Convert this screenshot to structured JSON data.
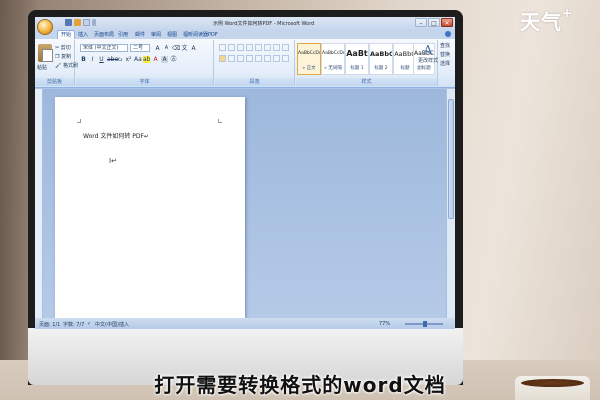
{
  "watermark": {
    "text": "天气",
    "plus": "+"
  },
  "window": {
    "title": "示例 Word文件如何转PDF - Microsoft Word",
    "controls": {
      "minimize": "–",
      "maximize": "□",
      "close": "✕"
    }
  },
  "tabs": [
    {
      "label": "开始",
      "active": true
    },
    {
      "label": "插入"
    },
    {
      "label": "页面布局"
    },
    {
      "label": "引用"
    },
    {
      "label": "邮件"
    },
    {
      "label": "审阅"
    },
    {
      "label": "视图"
    },
    {
      "label": "福昕阅读器PDF"
    }
  ],
  "ribbon": {
    "clipboard": {
      "paste_label": "粘贴",
      "cut_label": "剪切",
      "copy_label": "复制",
      "format_label": "格式刷",
      "group_label": "剪贴板"
    },
    "font": {
      "font_name": "宋体 (中文正文)",
      "font_size": "二号",
      "group_label": "字体"
    },
    "paragraph": {
      "group_label": "段落"
    },
    "styles": {
      "group_label": "样式",
      "tiles": [
        {
          "sample": "AaBbCcDd",
          "name": "» 正文",
          "active": true
        },
        {
          "sample": "AaBbCcDd",
          "name": "» 无间隔"
        },
        {
          "sample": "AaBt",
          "name": "标题 1"
        },
        {
          "sample": "AaBbC",
          "name": "标题 2"
        },
        {
          "sample": "AaBbC",
          "name": "标题"
        },
        {
          "sample": "AaBbC",
          "name": "副标题"
        }
      ],
      "change_styles": "更改样式"
    },
    "editing": {
      "find": "查找",
      "replace": "替换",
      "select": "选择",
      "group_label": "编辑"
    }
  },
  "document": {
    "line1": "Word 文件如何转 PDF↵",
    "cursor_mark": "I↵"
  },
  "statusbar": {
    "page": "页面: 1/1",
    "words": "字数: 7/7",
    "language": "中文(中国)",
    "mode": "插入",
    "zoom": "77%"
  },
  "subtitle": "打开需要转换格式的word文档"
}
